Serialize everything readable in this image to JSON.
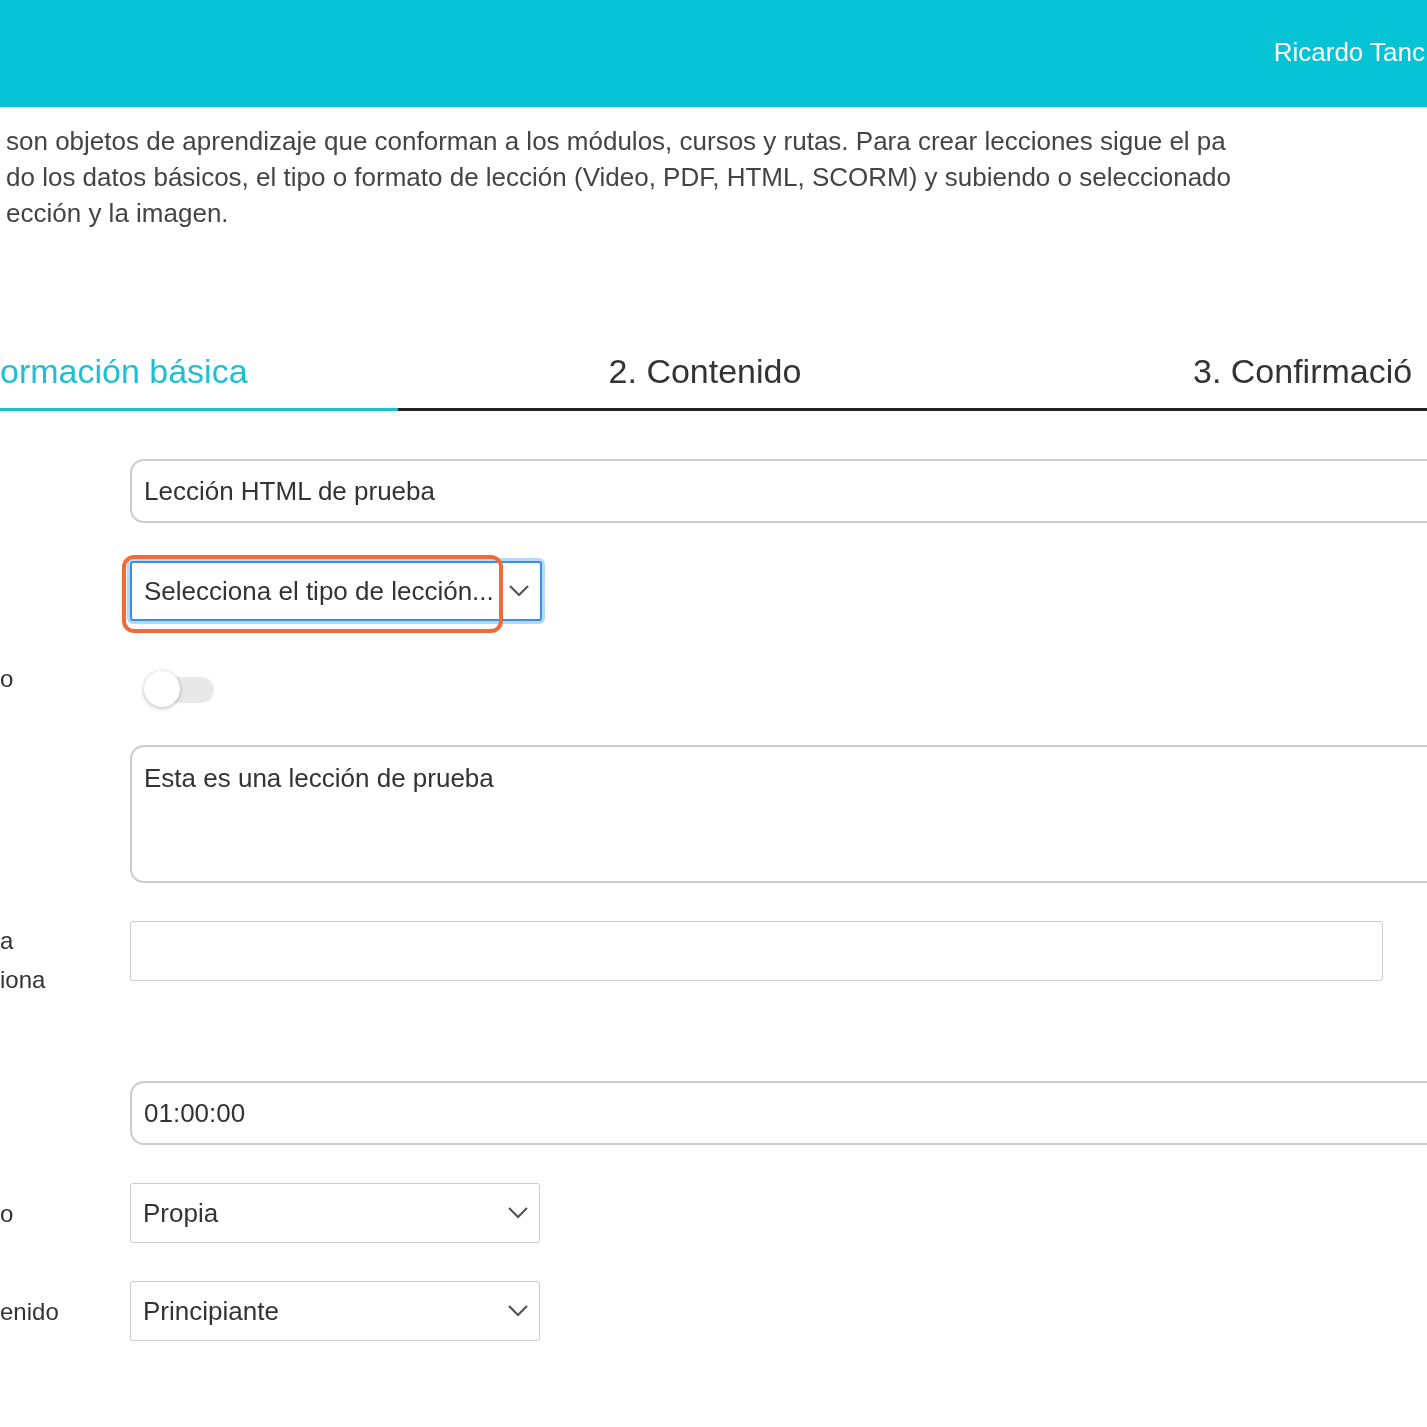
{
  "header": {
    "user": "Ricardo Tanc"
  },
  "description": [
    "son objetos de aprendizaje que conforman a los módulos, cursos y rutas. Para crear lecciones sigue el pa",
    "do los datos básicos, el tipo o formato de lección (Video, PDF, HTML, SCORM) y subiendo o seleccionado",
    "ección y la imagen."
  ],
  "tabs": [
    {
      "label": "ormación básica",
      "selected": true
    },
    {
      "label": "2. Contenido",
      "selected": false
    },
    {
      "label": "3. Confirmació",
      "selected": false
    }
  ],
  "fields": [
    {
      "kind": "text",
      "value": "Lección HTML de prueba"
    },
    {
      "kind": "select",
      "placeholder": "Selecciona el tipo de lección...",
      "focused": true,
      "highlighted": true
    },
    {
      "kind": "toggle",
      "label": "o",
      "on": false
    },
    {
      "kind": "textarea",
      "value": "Esta es una lección de prueba"
    },
    {
      "kind": "plain",
      "label": "a\niona"
    },
    {
      "kind": "text",
      "value": "01:00:00"
    },
    {
      "kind": "select",
      "label": "o",
      "value": "Propia",
      "focused": false,
      "highlighted": false
    },
    {
      "kind": "select",
      "label": "enido",
      "value": "Principiante",
      "focused": false,
      "highlighted": false
    }
  ]
}
